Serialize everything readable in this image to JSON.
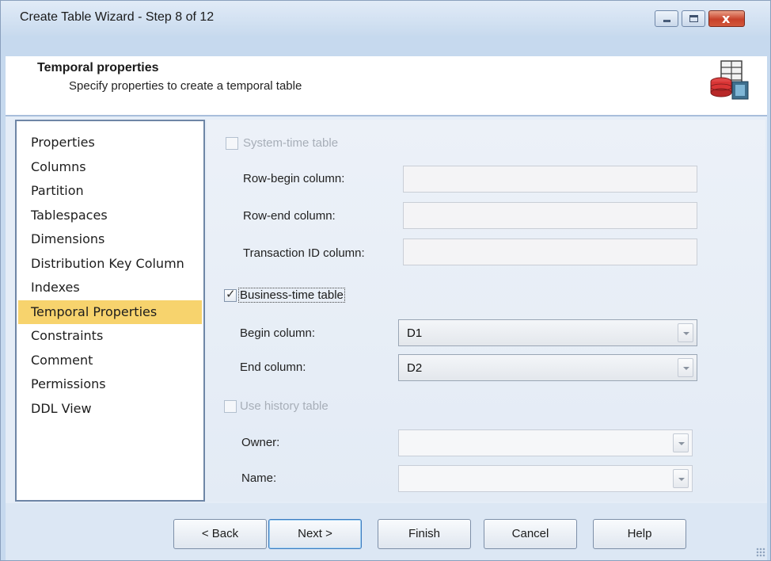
{
  "window": {
    "title": "Create Table Wizard - Step 8 of 12",
    "controls": {
      "minimize": "minimize",
      "maximize": "maximize",
      "close": "x"
    }
  },
  "header": {
    "title": "Temporal properties",
    "subtitle": "Specify properties to create a temporal table",
    "icon": "database-table-icon"
  },
  "nav": {
    "items": [
      {
        "label": "Properties",
        "selected": false
      },
      {
        "label": "Columns",
        "selected": false
      },
      {
        "label": "Partition",
        "selected": false
      },
      {
        "label": "Tablespaces",
        "selected": false
      },
      {
        "label": "Dimensions",
        "selected": false
      },
      {
        "label": "Distribution Key Column",
        "selected": false
      },
      {
        "label": "Indexes",
        "selected": false
      },
      {
        "label": "Temporal Properties",
        "selected": true
      },
      {
        "label": "Constraints",
        "selected": false
      },
      {
        "label": "Comment",
        "selected": false
      },
      {
        "label": "Permissions",
        "selected": false
      },
      {
        "label": "DDL View",
        "selected": false
      }
    ]
  },
  "system_time": {
    "label": "System-time table",
    "checked": false,
    "enabled": false,
    "row_begin_label": "Row-begin column:",
    "row_begin_value": "",
    "row_end_label": "Row-end column:",
    "row_end_value": "",
    "transaction_id_label": "Transaction ID column:",
    "transaction_id_value": ""
  },
  "business_time": {
    "label": "Business-time table",
    "checked": true,
    "enabled": true,
    "begin_label": "Begin column:",
    "begin_value": "D1",
    "end_label": "End column:",
    "end_value": "D2"
  },
  "history": {
    "label": "Use history table",
    "checked": false,
    "enabled": false,
    "owner_label": "Owner:",
    "owner_value": "",
    "name_label": "Name:",
    "name_value": ""
  },
  "footer": {
    "back": "< Back",
    "next": "Next >",
    "finish": "Finish",
    "cancel": "Cancel",
    "help": "Help"
  }
}
